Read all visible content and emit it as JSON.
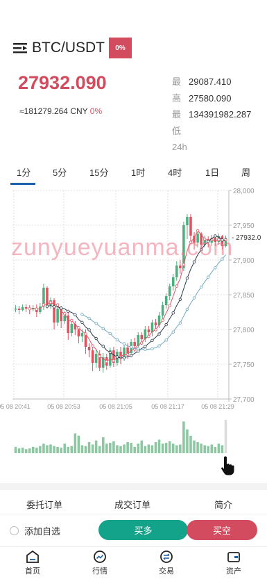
{
  "header": {
    "pair": "BTC/USDT",
    "change_badge": "0%"
  },
  "price": {
    "last": "27932.090",
    "cny": "≈181279.264 CNY",
    "cny_change": "0%"
  },
  "stats": {
    "labels": [
      "最高",
      "最低",
      "24h"
    ],
    "values": [
      "29087.410",
      "27580.090",
      "134391982.287"
    ]
  },
  "timeframes": [
    "1分",
    "5分",
    "15分",
    "1时",
    "4时",
    "1日",
    "周"
  ],
  "active_timeframe": "1分",
  "chart": {
    "y_ticks": [
      "28,000",
      "27,950",
      "27,900",
      "27,850",
      "27,800",
      "27,750",
      "27,700"
    ],
    "x_ticks": [
      "05 08 20:41",
      "05 08 20:53",
      "05 08 21:05",
      "05 08 21:17",
      "05 08 21:29"
    ],
    "current_price_label": "- 27932.0",
    "watermark": "zunyueyuanma.com"
  },
  "chart_data": {
    "type": "candlestick",
    "ylim": [
      27700,
      28000
    ],
    "up_color": "#4caf7d",
    "down_color": "#e05260",
    "ma_colors": [
      "#e05260",
      "#2d3a4a",
      "#6fa9c0"
    ],
    "candles": [
      [
        27830,
        27830,
        27825,
        27835
      ],
      [
        27830,
        27828,
        27822,
        27834
      ],
      [
        27828,
        27832,
        27826,
        27836
      ],
      [
        27832,
        27830,
        27825,
        27836
      ],
      [
        27830,
        27829,
        27822,
        27835
      ],
      [
        27829,
        27831,
        27826,
        27835
      ],
      [
        27831,
        27825,
        27818,
        27836
      ],
      [
        27825,
        27833,
        27822,
        27838
      ],
      [
        27833,
        27860,
        27828,
        27866
      ],
      [
        27860,
        27835,
        27830,
        27862
      ],
      [
        27835,
        27842,
        27830,
        27846
      ],
      [
        27842,
        27810,
        27800,
        27845
      ],
      [
        27810,
        27830,
        27805,
        27836
      ],
      [
        27830,
        27812,
        27802,
        27834
      ],
      [
        27812,
        27820,
        27808,
        27826
      ],
      [
        27820,
        27795,
        27785,
        27824
      ],
      [
        27795,
        27808,
        27790,
        27812
      ],
      [
        27808,
        27800,
        27792,
        27812
      ],
      [
        27800,
        27790,
        27780,
        27805
      ],
      [
        27790,
        27795,
        27782,
        27800
      ],
      [
        27795,
        27775,
        27765,
        27800
      ],
      [
        27775,
        27770,
        27760,
        27780
      ],
      [
        27770,
        27752,
        27740,
        27775
      ],
      [
        27752,
        27765,
        27745,
        27770
      ],
      [
        27765,
        27745,
        27740,
        27770
      ],
      [
        27745,
        27760,
        27738,
        27766
      ],
      [
        27760,
        27748,
        27742,
        27765
      ],
      [
        27748,
        27770,
        27745,
        27774
      ],
      [
        27770,
        27752,
        27746,
        27775
      ],
      [
        27752,
        27768,
        27748,
        27772
      ],
      [
        27768,
        27760,
        27750,
        27775
      ],
      [
        27760,
        27774,
        27755,
        27780
      ],
      [
        27774,
        27766,
        27758,
        27780
      ],
      [
        27766,
        27782,
        27760,
        27786
      ],
      [
        27782,
        27776,
        27768,
        27788
      ],
      [
        27776,
        27792,
        27770,
        27796
      ],
      [
        27792,
        27786,
        27778,
        27796
      ],
      [
        27786,
        27800,
        27782,
        27805
      ],
      [
        27800,
        27796,
        27788,
        27805
      ],
      [
        27796,
        27810,
        27790,
        27814
      ],
      [
        27810,
        27806,
        27800,
        27815
      ],
      [
        27806,
        27820,
        27802,
        27825
      ],
      [
        27820,
        27835,
        27815,
        27840
      ],
      [
        27835,
        27848,
        27830,
        27852
      ],
      [
        27848,
        27862,
        27842,
        27866
      ],
      [
        27862,
        27875,
        27856,
        27880
      ],
      [
        27875,
        27892,
        27870,
        27898
      ],
      [
        27892,
        27888,
        27880,
        27900
      ],
      [
        27888,
        27950,
        27884,
        27955
      ],
      [
        27950,
        27962,
        27930,
        27966
      ],
      [
        27962,
        27935,
        27925,
        27966
      ],
      [
        27935,
        27925,
        27915,
        27940
      ],
      [
        27925,
        27938,
        27918,
        27942
      ],
      [
        27938,
        27922,
        27915,
        27940
      ],
      [
        27922,
        27930,
        27918,
        27935
      ],
      [
        27930,
        27925,
        27918,
        27934
      ],
      [
        27925,
        27932,
        27920,
        27936
      ],
      [
        27932,
        27926,
        27920,
        27936
      ],
      [
        27926,
        27934,
        27922,
        27938
      ],
      [
        27934,
        27920,
        27915,
        27936
      ],
      [
        27920,
        27932,
        27918,
        27935
      ]
    ],
    "volumes": [
      8,
      6,
      7,
      5,
      6,
      8,
      7,
      9,
      12,
      10,
      11,
      9,
      8,
      7,
      12,
      8,
      9,
      25,
      22,
      10,
      9,
      14,
      11,
      16,
      9,
      20,
      12,
      13,
      15,
      10,
      9,
      11,
      14,
      13,
      8,
      12,
      16,
      9,
      11,
      10,
      14,
      17,
      12,
      13,
      15,
      12,
      10,
      11,
      40,
      30,
      22,
      16,
      14,
      12,
      10,
      9,
      11,
      8,
      12,
      10,
      42
    ]
  },
  "tabs2": [
    "委托订单",
    "成交订单",
    "简介"
  ],
  "actions": {
    "favorite": "添加自选",
    "long": "买多",
    "short": "买空"
  },
  "nav": [
    "首页",
    "行情",
    "交易",
    "资产"
  ]
}
